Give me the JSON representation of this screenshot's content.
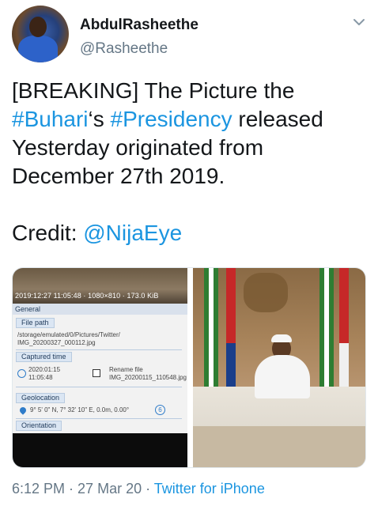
{
  "user": {
    "display_name": "AbdulRasheethe",
    "handle": "@Rasheethe"
  },
  "tweet": {
    "lines": [
      [
        {
          "t": "[BREAKING] The Picture the",
          "link": false
        }
      ],
      [
        {
          "t": "#Buhari",
          "link": true
        },
        {
          "t": "‘s ",
          "link": false
        },
        {
          "t": "#Presidency",
          "link": true
        },
        {
          "t": " released",
          "link": false
        }
      ],
      [
        {
          "t": "Yesterday originated from",
          "link": false
        }
      ],
      [
        {
          "t": "December 27th 2019.",
          "link": false
        }
      ],
      [],
      [
        {
          "t": "Credit: ",
          "link": false
        },
        {
          "t": "@NijaEye",
          "link": true
        }
      ]
    ]
  },
  "media_left": {
    "meta": "2019:12:27 11:05:48 · 1080×810 · 173.0 KiB",
    "section_general": "General",
    "file_path_label": "File path",
    "file_path_line1": "/storage/emulated/0/Pictures/Twitter/",
    "file_path_line2": "IMG_20200327_000112.jpg",
    "captured_label": "Captured time",
    "captured_date": "2020:01:15",
    "captured_time": "11:05:48",
    "rename_label": "Rename file",
    "rename_value": "IMG_20200115_110548.jpg",
    "geo_label": "Geolocation",
    "geo_value": "9° 5' 0\" N, 7° 32' 10\" E,  0.0m, 0.00°",
    "geo_badge": "6",
    "orientation_label": "Orientation"
  },
  "footer": {
    "time": "6:12 PM",
    "sep1": " · ",
    "date": "27 Mar 20",
    "sep2": " · ",
    "source": "Twitter for iPhone"
  },
  "colors": {
    "link": "#1b95e0",
    "muted": "#657786",
    "text": "#14171a"
  },
  "icons": {
    "more": "chevron-down-icon",
    "clock": "clock-icon",
    "pin": "location-pin-icon",
    "checkbox": "checkbox-icon"
  }
}
